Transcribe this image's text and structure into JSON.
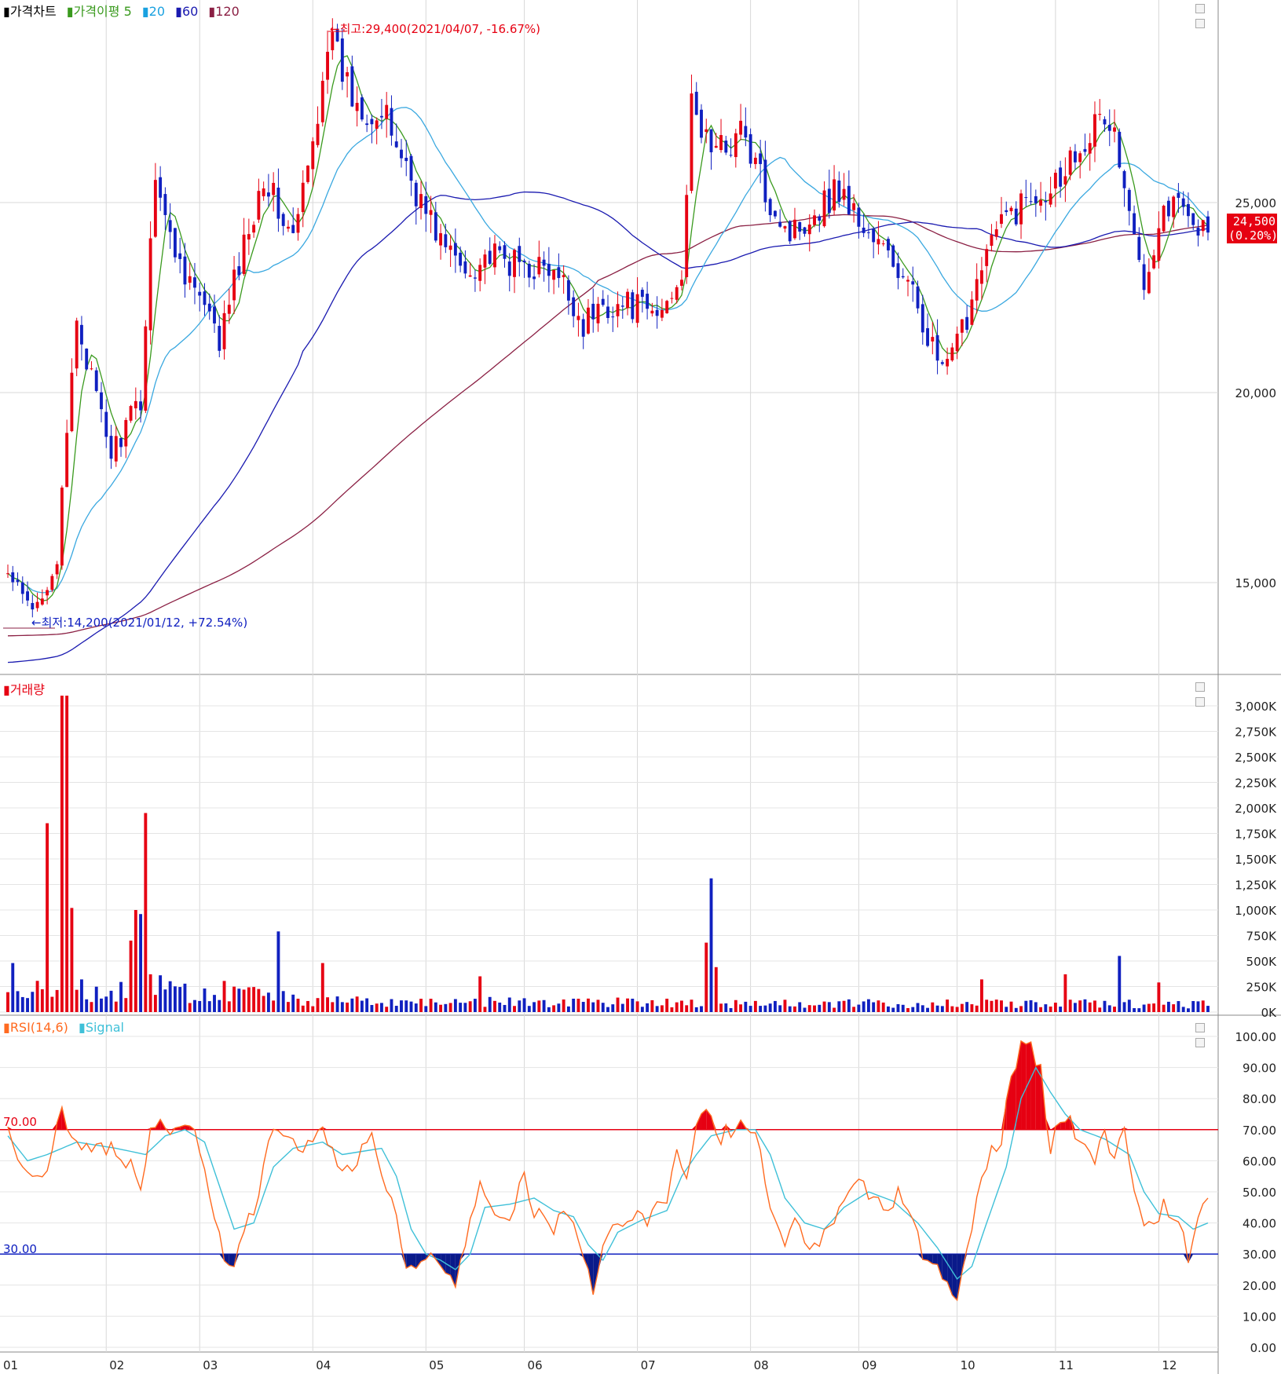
{
  "panels": {
    "price": {
      "legend": [
        {
          "label": "가격차트",
          "color": "#000000"
        },
        {
          "label": "가격이평 5",
          "color": "#3a9a1e"
        },
        {
          "label": "20",
          "color": "#1aa1e0"
        },
        {
          "label": "60",
          "color": "#1a1ab0"
        },
        {
          "label": "120",
          "color": "#8b2044"
        }
      ],
      "annotation_high": "←최고:29,400(2021/04/07, -16.67%)",
      "annotation_low": "←최저:14,200(2021/01/12, +72.54%)",
      "current_price": "24,500",
      "current_change": "(0.20%)"
    },
    "volume": {
      "legend": [
        {
          "label": "거래량",
          "color": "#e60012"
        }
      ]
    },
    "rsi": {
      "legend": [
        {
          "label": "RSI(14,6)",
          "color": "#ff6a20"
        },
        {
          "label": "Signal",
          "color": "#3fc0d8"
        }
      ],
      "level_high_label": "70.00",
      "level_low_label": "30.00"
    }
  },
  "colors": {
    "up": "#e60012",
    "down": "#1020c0",
    "ma5": "#3a9a1e",
    "ma20": "#3aa8e0",
    "ma60": "#1a1ab0",
    "ma120": "#8b2044",
    "rsi": "#ff6a20",
    "signal": "#3fc0d8"
  },
  "chart_data": [
    {
      "type": "candlestick",
      "ylim": [
        12500,
        30500
      ],
      "y_ticks": [
        15000,
        20000,
        25000
      ],
      "y_tick_labels": [
        "15,000",
        "20,000",
        "25,000"
      ],
      "x_tick_labels": [
        "01",
        "02",
        "03",
        "04",
        "05",
        "06",
        "07",
        "08",
        "09",
        "10",
        "11",
        "12"
      ],
      "close_path": [
        [
          0,
          15200
        ],
        [
          5,
          14200
        ],
        [
          10,
          15600
        ],
        [
          14,
          22000
        ],
        [
          18,
          19800
        ],
        [
          21,
          18400
        ],
        [
          27,
          19800
        ],
        [
          30,
          26000
        ],
        [
          33,
          24000
        ],
        [
          37,
          23000
        ],
        [
          43,
          21300
        ],
        [
          46,
          22900
        ],
        [
          52,
          25800
        ],
        [
          55,
          24800
        ],
        [
          58,
          24000
        ],
        [
          62,
          26500
        ],
        [
          65,
          29400
        ],
        [
          70,
          27800
        ],
        [
          73,
          27500
        ],
        [
          77,
          27100
        ],
        [
          80,
          26300
        ],
        [
          84,
          25000
        ],
        [
          89,
          23800
        ],
        [
          93,
          23200
        ],
        [
          97,
          23600
        ],
        [
          102,
          23400
        ],
        [
          108,
          23300
        ],
        [
          113,
          22800
        ],
        [
          117,
          21800
        ],
        [
          121,
          22300
        ],
        [
          127,
          22300
        ],
        [
          132,
          22000
        ],
        [
          134,
          22400
        ],
        [
          137,
          23300
        ],
        [
          139,
          27400
        ],
        [
          144,
          26300
        ],
        [
          149,
          26900
        ],
        [
          154,
          25300
        ],
        [
          159,
          24200
        ],
        [
          164,
          24800
        ],
        [
          169,
          25400
        ],
        [
          174,
          24300
        ],
        [
          179,
          23600
        ],
        [
          185,
          22300
        ],
        [
          189,
          20800
        ],
        [
          191,
          20600
        ],
        [
          195,
          22000
        ],
        [
          198,
          23600
        ],
        [
          203,
          24600
        ],
        [
          208,
          25200
        ],
        [
          213,
          25600
        ],
        [
          219,
          26800
        ],
        [
          223,
          27200
        ],
        [
          225,
          26800
        ],
        [
          228,
          24500
        ],
        [
          231,
          23100
        ],
        [
          235,
          24900
        ],
        [
          240,
          25000
        ],
        [
          242,
          24200
        ],
        [
          244,
          24500
        ]
      ],
      "ma_series_names": [
        "5",
        "20",
        "60",
        "120"
      ],
      "high": {
        "value": 29400,
        "date": "2021/04/07"
      },
      "low": {
        "value": 14200,
        "date": "2021/01/12"
      },
      "last": 24500
    },
    {
      "type": "bar",
      "title": "거래량",
      "ylim": [
        0,
        3100000
      ],
      "y_tick_labels": [
        "0K",
        "250K",
        "500K",
        "750K",
        "1,000K",
        "1,250K",
        "1,500K",
        "1,750K",
        "2,000K",
        "2,250K",
        "2,500K",
        "2,750K",
        "3,000K"
      ],
      "spikes": [
        [
          1,
          480000
        ],
        [
          8,
          1850000
        ],
        [
          11,
          3100000
        ],
        [
          12,
          3100000
        ],
        [
          13,
          1020000
        ],
        [
          15,
          320000
        ],
        [
          25,
          700000
        ],
        [
          26,
          1000000
        ],
        [
          27,
          960000
        ],
        [
          28,
          1950000
        ],
        [
          29,
          370000
        ],
        [
          31,
          360000
        ],
        [
          55,
          790000
        ],
        [
          64,
          480000
        ],
        [
          96,
          350000
        ],
        [
          142,
          680000
        ],
        [
          143,
          1310000
        ],
        [
          144,
          440000
        ],
        [
          198,
          320000
        ],
        [
          215,
          370000
        ],
        [
          226,
          550000
        ],
        [
          234,
          290000
        ]
      ]
    },
    {
      "type": "line",
      "title": "RSI(14,6)",
      "ylim": [
        0,
        100
      ],
      "y_tick_labels": [
        "0.00",
        "10.00",
        "20.00",
        "30.00",
        "40.00",
        "50.00",
        "60.00",
        "70.00",
        "80.00",
        "90.00",
        "100.00"
      ],
      "levels": [
        70,
        30
      ],
      "rsi_path": [
        [
          0,
          70
        ],
        [
          2,
          63
        ],
        [
          5,
          55
        ],
        [
          8,
          58
        ],
        [
          11,
          75
        ],
        [
          13,
          66
        ],
        [
          17,
          65
        ],
        [
          22,
          63
        ],
        [
          26,
          58
        ],
        [
          27,
          48
        ],
        [
          29,
          72
        ],
        [
          31,
          74
        ],
        [
          34,
          70
        ],
        [
          38,
          69
        ],
        [
          40,
          60
        ],
        [
          42,
          42
        ],
        [
          44,
          27
        ],
        [
          46,
          27
        ],
        [
          48,
          40
        ],
        [
          51,
          48
        ],
        [
          53,
          68
        ],
        [
          56,
          66
        ],
        [
          60,
          65
        ],
        [
          64,
          70
        ],
        [
          66,
          62
        ],
        [
          68,
          55
        ],
        [
          70,
          58
        ],
        [
          74,
          70
        ],
        [
          76,
          58
        ],
        [
          79,
          40
        ],
        [
          81,
          27
        ],
        [
          84,
          28
        ],
        [
          87,
          30
        ],
        [
          89,
          23
        ],
        [
          91,
          21
        ],
        [
          94,
          40
        ],
        [
          96,
          55
        ],
        [
          98,
          45
        ],
        [
          102,
          43
        ],
        [
          105,
          55
        ],
        [
          107,
          40
        ],
        [
          109,
          45
        ],
        [
          111,
          38
        ],
        [
          114,
          44
        ],
        [
          117,
          30
        ],
        [
          119,
          18
        ],
        [
          121,
          35
        ],
        [
          124,
          40
        ],
        [
          127,
          42
        ],
        [
          130,
          40
        ],
        [
          134,
          48
        ],
        [
          136,
          62
        ],
        [
          138,
          52
        ],
        [
          140,
          70
        ],
        [
          142,
          76
        ],
        [
          145,
          68
        ],
        [
          148,
          70
        ],
        [
          151,
          72
        ],
        [
          153,
          66
        ],
        [
          155,
          45
        ],
        [
          158,
          35
        ],
        [
          160,
          40
        ],
        [
          163,
          30
        ],
        [
          166,
          38
        ],
        [
          168,
          40
        ],
        [
          170,
          50
        ],
        [
          173,
          55
        ],
        [
          176,
          48
        ],
        [
          179,
          42
        ],
        [
          181,
          50
        ],
        [
          184,
          42
        ],
        [
          186,
          30
        ],
        [
          188,
          26
        ],
        [
          191,
          20
        ],
        [
          193,
          16
        ],
        [
          195,
          30
        ],
        [
          197,
          48
        ],
        [
          199,
          60
        ],
        [
          202,
          68
        ],
        [
          204,
          85
        ],
        [
          206,
          98
        ],
        [
          208,
          96
        ],
        [
          210,
          88
        ],
        [
          212,
          65
        ],
        [
          214,
          74
        ],
        [
          216,
          75
        ],
        [
          218,
          65
        ],
        [
          221,
          60
        ],
        [
          223,
          68
        ],
        [
          225,
          62
        ],
        [
          227,
          69
        ],
        [
          229,
          52
        ],
        [
          231,
          38
        ],
        [
          233,
          40
        ],
        [
          235,
          45
        ],
        [
          238,
          40
        ],
        [
          240,
          30
        ],
        [
          242,
          42
        ],
        [
          244,
          46
        ]
      ],
      "signal_path": [
        [
          0,
          68
        ],
        [
          4,
          60
        ],
        [
          8,
          62
        ],
        [
          14,
          66
        ],
        [
          22,
          64
        ],
        [
          28,
          62
        ],
        [
          32,
          68
        ],
        [
          36,
          70
        ],
        [
          40,
          66
        ],
        [
          43,
          52
        ],
        [
          46,
          38
        ],
        [
          50,
          40
        ],
        [
          54,
          58
        ],
        [
          58,
          64
        ],
        [
          64,
          66
        ],
        [
          68,
          62
        ],
        [
          72,
          63
        ],
        [
          76,
          64
        ],
        [
          79,
          55
        ],
        [
          82,
          38
        ],
        [
          85,
          30
        ],
        [
          88,
          28
        ],
        [
          91,
          25
        ],
        [
          94,
          30
        ],
        [
          97,
          45
        ],
        [
          102,
          46
        ],
        [
          107,
          48
        ],
        [
          111,
          44
        ],
        [
          115,
          42
        ],
        [
          118,
          33
        ],
        [
          121,
          28
        ],
        [
          124,
          37
        ],
        [
          129,
          41
        ],
        [
          134,
          44
        ],
        [
          137,
          55
        ],
        [
          140,
          62
        ],
        [
          143,
          68
        ],
        [
          148,
          70
        ],
        [
          152,
          70
        ],
        [
          155,
          62
        ],
        [
          158,
          48
        ],
        [
          162,
          40
        ],
        [
          166,
          38
        ],
        [
          170,
          45
        ],
        [
          175,
          50
        ],
        [
          180,
          47
        ],
        [
          185,
          40
        ],
        [
          189,
          32
        ],
        [
          193,
          22
        ],
        [
          196,
          26
        ],
        [
          199,
          40
        ],
        [
          203,
          58
        ],
        [
          206,
          80
        ],
        [
          209,
          90
        ],
        [
          212,
          82
        ],
        [
          215,
          75
        ],
        [
          218,
          70
        ],
        [
          223,
          67
        ],
        [
          228,
          62
        ],
        [
          231,
          50
        ],
        [
          234,
          43
        ],
        [
          238,
          42
        ],
        [
          241,
          38
        ],
        [
          244,
          40
        ]
      ]
    }
  ]
}
